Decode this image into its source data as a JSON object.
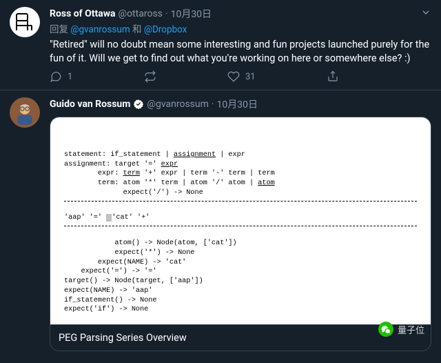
{
  "tweet1": {
    "display_name": "Ross of Ottawa",
    "handle": "@ottaross",
    "sep": "·",
    "date": "10月30日",
    "reply_prefix": "回复 ",
    "mention1": "@gvanrossum",
    "reply_mid": " 和 ",
    "mention2": "@Dropbox",
    "text": "\"Retired\" will no doubt mean some interesting and fun projects launched purely for the fun of it. Will we get to find out what you're working on here or somewhere else? :)",
    "reply_count": "1",
    "like_count": "31"
  },
  "tweet2": {
    "display_name": "Guido van Rossum",
    "handle": "@gvanrossum",
    "sep": "·",
    "date": "10月30日",
    "card": {
      "line1a": "statement: if_statement | ",
      "line1b": "assignment",
      "line1c": " | expr",
      "line2a": "assignment: target '=' ",
      "line2b": "expr",
      "line3a": "        expr: ",
      "line3b": "term",
      "line3c": " '+' expr | term '-' term | term",
      "line4a": "        term: atom '*' term | atom '/' atom | ",
      "line4b": "atom",
      "line5": "              expect('/') -> None",
      "line6a": "'aap' '=' ",
      "line6b": "'cat'",
      "line6c": " '+'",
      "line7": "            atom() -> Node(atom, ['cat'])",
      "line8": "            expect('*') -> None",
      "line9": "        expect(NAME) -> 'cat'",
      "line10": "    expect('=') -> '='",
      "line11": "target() -> Node(target, ['aap'])",
      "line12": "expect(NAME) -> 'aap'",
      "line13": "if_statement() -> None",
      "line14": "expect('if') -> None",
      "title": "PEG Parsing Series Overview"
    }
  },
  "watermark": {
    "text": "量子位"
  }
}
